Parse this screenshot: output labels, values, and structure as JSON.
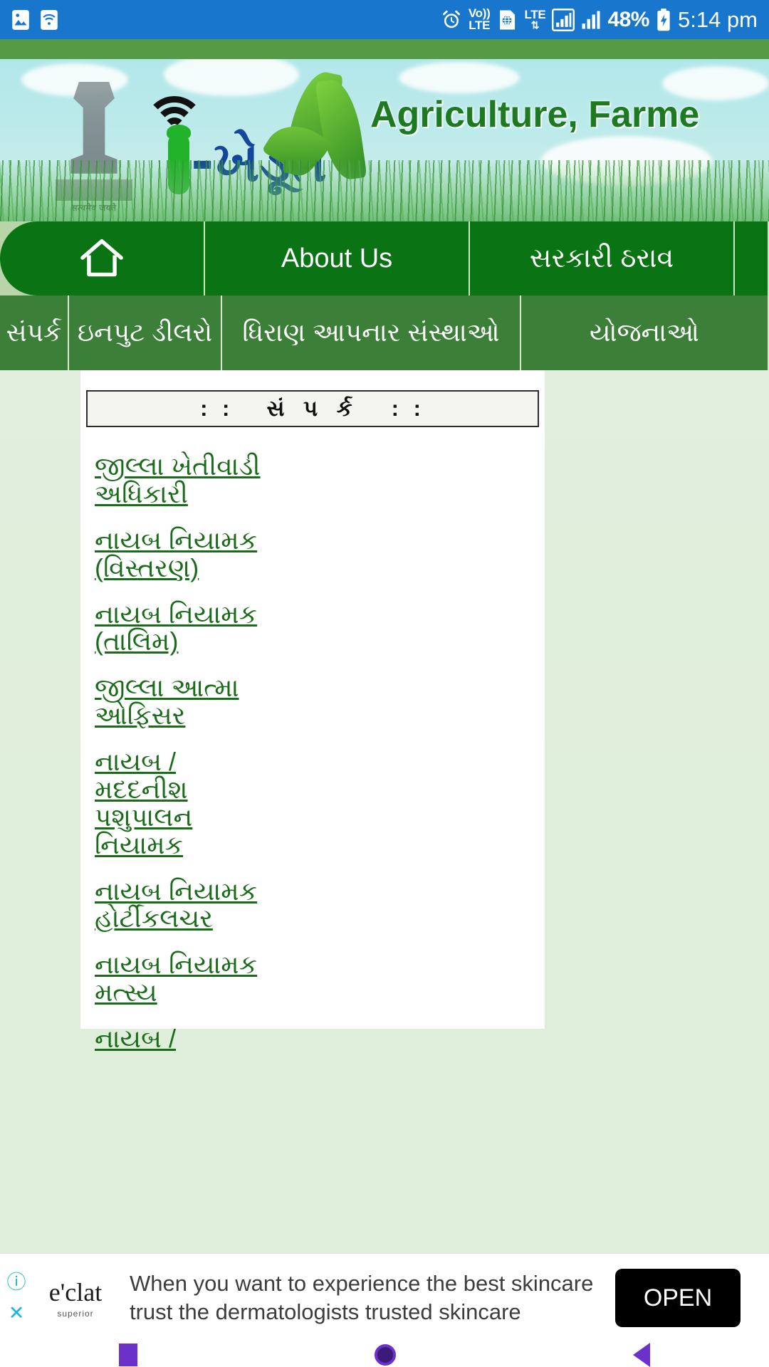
{
  "statusbar": {
    "time": "5:14 pm",
    "battery": "48%",
    "icons": {
      "gallery": "image-icon",
      "wifi": "wifi-icon",
      "alarm": "alarm-icon",
      "volte_line1": "Vo))",
      "volte_line2": "LTE",
      "sim": "sim-globe-icon",
      "lte_label": "LTE",
      "signal1": "signal-bars-icon",
      "signal2": "signal-bars-icon",
      "battery_charging": "battery-charging-icon"
    }
  },
  "banner": {
    "logo_text": "i-ખેડૂત",
    "logo_i": "i",
    "logo_word": "-ખેડૂત",
    "title": "Agriculture, Farme",
    "emblem_motto": "सत्यमेव जयते"
  },
  "nav_primary": [
    {
      "label": "",
      "icon": "home-icon",
      "name": "home"
    },
    {
      "label": "About Us",
      "icon": "",
      "name": "about-us"
    },
    {
      "label": "સરકારી ઠરાવ",
      "icon": "",
      "name": "sarkari-tharav"
    },
    {
      "label": "",
      "icon": "",
      "name": "more"
    }
  ],
  "nav_secondary": [
    {
      "label": "સંપર્ક",
      "name": "sampark"
    },
    {
      "label": "ઇનપુટ ડીલરો",
      "name": "input-dealers"
    },
    {
      "label": "ધિરાણ આપનાર સંસ્થાઓ",
      "name": "lending-institutions"
    },
    {
      "label": "યોજનાઓ",
      "name": "yojanao"
    }
  ],
  "content": {
    "title_left_dots": ": :",
    "title_label": "સં પ ર્ક",
    "title_right_dots": ": :",
    "links": [
      "જીલ્લા ખેતીવાડી અધિકારી",
      "નાયબ નિયામક (વિસ્તરણ)",
      "નાયબ નિયામક (તાલિમ)",
      "જીલ્લા આત્મા ઓફિસર",
      "નાયબ / મદદનીશ પશુપાલન નિયામક",
      "નાયબ નિયામક હોર્ટીકલચર",
      "નાયબ નિયામક મત્સ્ય",
      "નાયબ /"
    ]
  },
  "ad": {
    "brand": "e'clat",
    "brand_sub": "superior",
    "copy": "When you want to experience the best skincare trust the dermatologists trusted skincare",
    "cta": "OPEN",
    "info_glyph": "ⓘ",
    "close_glyph": "✕"
  },
  "sysnav": {
    "recent": "square-recents-icon",
    "home": "circle-home-icon",
    "back": "triangle-back-icon"
  },
  "colors": {
    "status_bar": "#1877cc",
    "nav_primary": "#0a7313",
    "nav_secondary": "#3c7f38",
    "link": "#1a6b1a",
    "page_bg": "#e2eede",
    "ad_cta_bg": "#000000",
    "sysnav_accent": "#6b31c9"
  }
}
